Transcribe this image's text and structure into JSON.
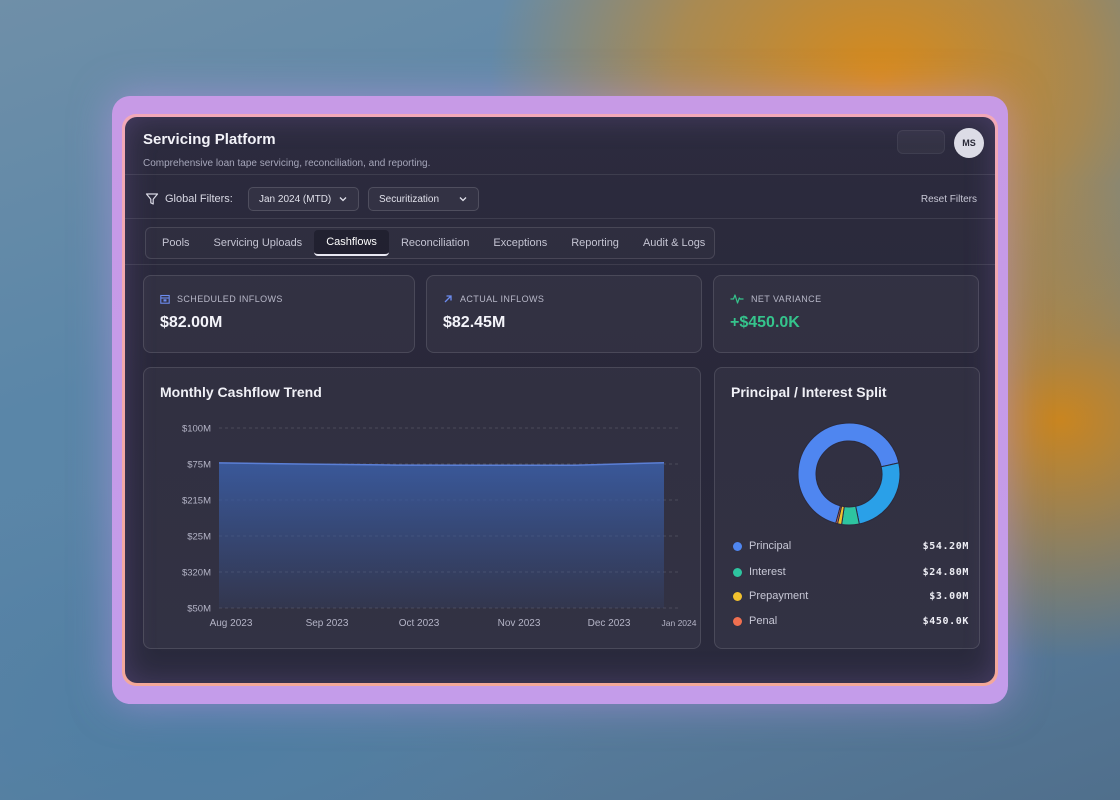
{
  "app": {
    "title": "Servicing Platform",
    "subtitle": "Comprehensive loan tape servicing, reconciliation, and reporting.",
    "avatar_initials": "MS"
  },
  "filters": {
    "label": "Global Filters:",
    "period": "Jan 2024 (MTD)",
    "segment": "Securitization",
    "reset_label": "Reset Filters"
  },
  "tabs": [
    {
      "label": "Pools",
      "active": false
    },
    {
      "label": "Servicing Uploads",
      "active": false
    },
    {
      "label": "Cashflows",
      "active": true
    },
    {
      "label": "Reconciliation",
      "active": false
    },
    {
      "label": "Exceptions",
      "active": false
    },
    {
      "label": "Reporting",
      "active": false
    },
    {
      "label": "Audit & Logs",
      "active": false
    }
  ],
  "kpis": {
    "scheduled": {
      "label": "SCHEDULED INFLOWS",
      "value": "$82.00M",
      "icon": "calendar-icon"
    },
    "actual": {
      "label": "ACTUAL INFLOWS",
      "value": "$82.45M",
      "icon": "arrow-up-right-icon"
    },
    "variance": {
      "label": "NET VARIANCE",
      "value": "+$450.0K",
      "icon": "pulse-icon",
      "color": "#35c48c"
    }
  },
  "trend": {
    "title": "Monthly Cashflow Trend"
  },
  "split": {
    "title": "Principal / Interest Split"
  },
  "colors": {
    "principal": "#4f86f0",
    "interest": "#2ec4a0",
    "prepayment": "#f2c12e",
    "penal": "#f07050",
    "interest_ring": "#2aa0e8",
    "area_fill": "#3a5a9e",
    "area_line": "#5b7fd6"
  },
  "chart_data": [
    {
      "type": "area",
      "title": "Monthly Cashflow Trend",
      "categories": [
        "Aug 2023",
        "Sep 2023",
        "Oct 2023",
        "Nov 2023",
        "Dec 2023",
        "Jan 2024"
      ],
      "y_tick_labels": [
        "$100M",
        "$75M",
        "$215M",
        "$25M",
        "$320M",
        "$50M"
      ],
      "values": [
        80.6,
        79.9,
        79.4,
        79.3,
        79.3,
        80.7
      ],
      "grid": true
    },
    {
      "type": "pie",
      "title": "Principal / Interest Split",
      "labels": [
        "Principal",
        "Interest",
        "Prepayment",
        "Penal"
      ],
      "values": [
        54.2,
        24.8,
        3.0,
        0.45
      ],
      "value_labels": [
        "$54.20M",
        "$24.80M",
        "$3.00M",
        "$450.0K"
      ]
    }
  ]
}
